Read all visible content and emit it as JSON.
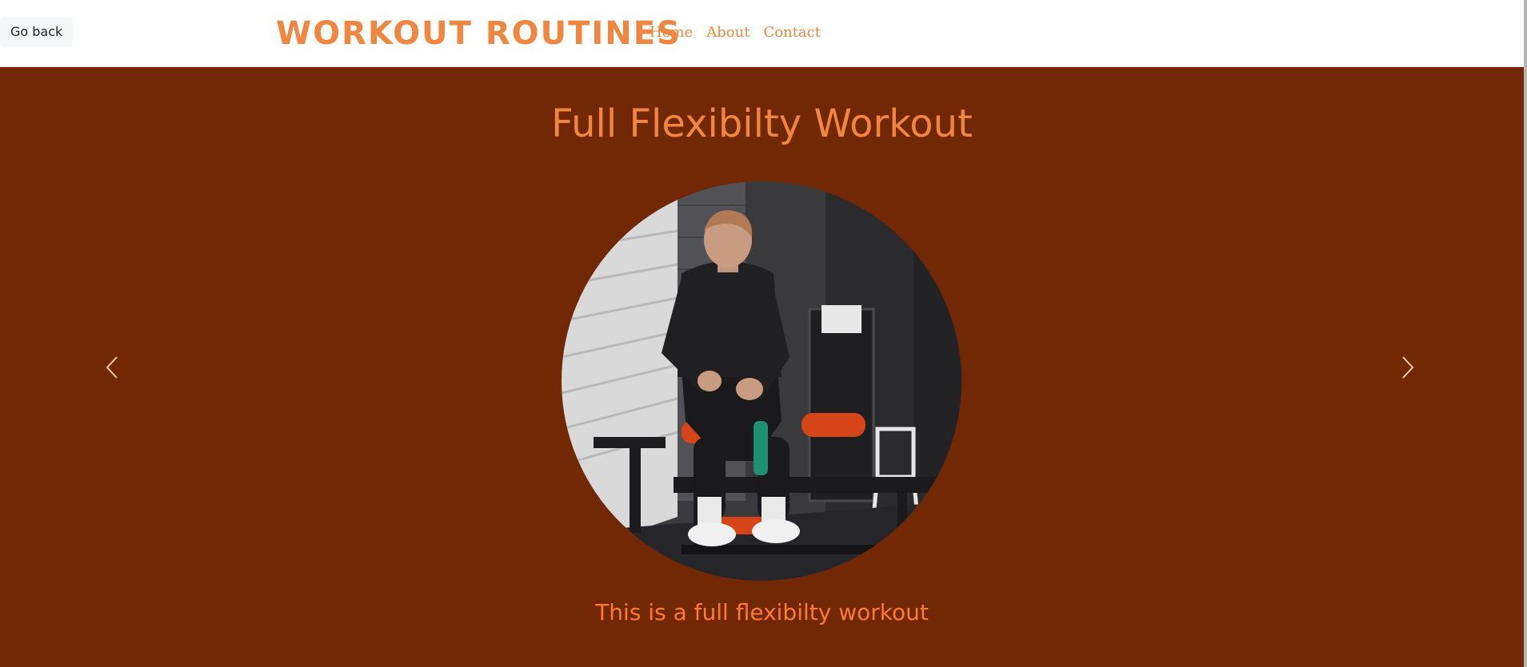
{
  "header": {
    "go_back_label": "Go back",
    "brand": "WORKOUT ROUTINES",
    "nav": [
      {
        "label": "Home"
      },
      {
        "label": "About"
      },
      {
        "label": "Contact"
      }
    ]
  },
  "slide": {
    "title": "Full Flexibilty Workout",
    "caption": "This is a full flexibilty workout",
    "prev_icon": "chevron-left-icon",
    "next_icon": "chevron-right-icon"
  },
  "colors": {
    "accent": "#f0863f",
    "caption": "#ff7a2a",
    "hero_background": "#722805",
    "header_background": "#ffffff"
  }
}
